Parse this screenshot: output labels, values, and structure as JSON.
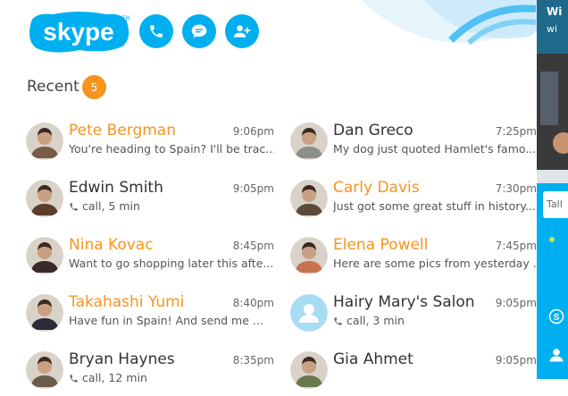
{
  "app": {
    "logo_text": "skype"
  },
  "header": {
    "buttons": [
      {
        "name": "call-button",
        "icon": "phone-icon"
      },
      {
        "name": "chat-button",
        "icon": "chat-bubble-icon"
      },
      {
        "name": "add-contact-button",
        "icon": "add-person-icon"
      }
    ]
  },
  "recent": {
    "label": "Recent",
    "badge": "5"
  },
  "contacts_left": [
    {
      "name": "Pete Bergman",
      "time": "9:06pm",
      "message": "You're heading to Spain? I'll be trac...",
      "unread": true,
      "type": "message",
      "avatar_color": "#7a5a48"
    },
    {
      "name": "Edwin Smith",
      "time": "9:05pm",
      "message": "call, 5 min",
      "unread": false,
      "type": "call",
      "avatar_color": "#5b3d2b"
    },
    {
      "name": "Nina Kovac",
      "time": "8:45pm",
      "message": "Want to go shopping later this afte...",
      "unread": true,
      "type": "message",
      "avatar_color": "#3b2a2a"
    },
    {
      "name": "Takahashi Yumi",
      "time": "8:40pm",
      "message": "Have fun in Spain! And send me ...",
      "unread": true,
      "type": "message",
      "avatar_color": "#2b2a36"
    },
    {
      "name": "Bryan Haynes",
      "time": "8:35pm",
      "message": "call, 12 min",
      "unread": false,
      "type": "call",
      "avatar_color": "#6b5b4a"
    }
  ],
  "contacts_right": [
    {
      "name": "Dan Greco",
      "time": "7:25pm",
      "message": "My dog just quoted Hamlet's famo...",
      "unread": false,
      "type": "message",
      "avatar_color": "#8a8f87"
    },
    {
      "name": "Carly Davis",
      "time": "7:30pm",
      "message": "Just got some great stuff in history...",
      "unread": true,
      "type": "message",
      "avatar_color": "#5a4b3b"
    },
    {
      "name": "Elena Powell",
      "time": "7:45pm",
      "message": "Here are some pics from yesterday ...",
      "unread": true,
      "type": "message",
      "avatar_color": "#c8734f"
    },
    {
      "name": "Hairy Mary's Salon",
      "time": "9:05pm",
      "message": "call, 3 min",
      "unread": false,
      "type": "call",
      "avatar_color": "#a7dcf3",
      "placeholder": true
    },
    {
      "name": "Gia Ahmet",
      "time": "9:05pm",
      "message": "",
      "unread": false,
      "type": "message",
      "avatar_color": "#6a7a50"
    }
  ],
  "side_panel": {
    "title": "Wi",
    "subtitle": "wi",
    "input_placeholder": "Tall"
  },
  "colors": {
    "accent": "#00aff0",
    "orange": "#f7941d"
  }
}
